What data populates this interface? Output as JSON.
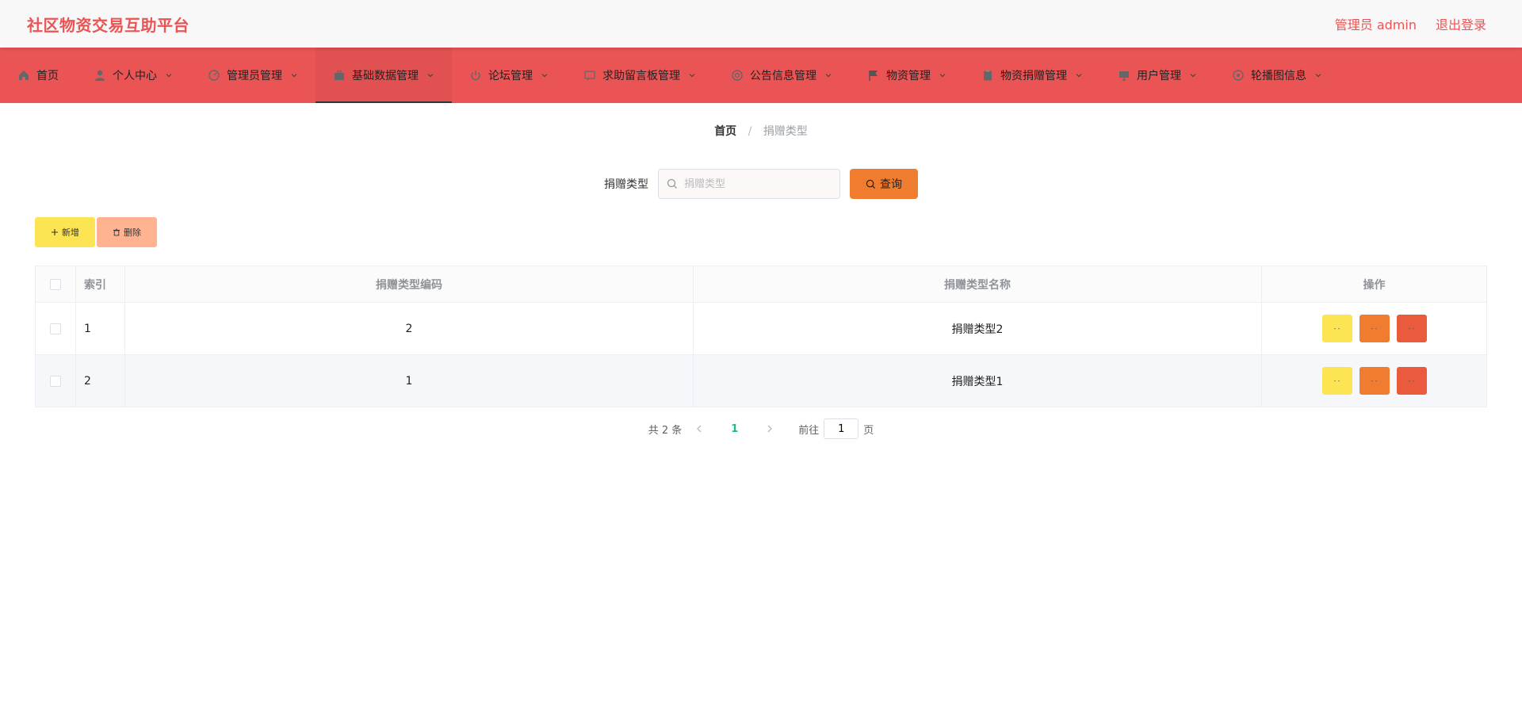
{
  "header": {
    "brand": "社区物资交易互助平台",
    "user_label": "管理员 admin",
    "logout_label": "退出登录"
  },
  "nav": {
    "items": [
      {
        "label": "首页",
        "icon": "home-icon",
        "has_menu": false
      },
      {
        "label": "个人中心",
        "icon": "user-icon",
        "has_menu": true
      },
      {
        "label": "管理员管理",
        "icon": "gauge-icon",
        "has_menu": true
      },
      {
        "label": "基础数据管理",
        "icon": "briefcase-icon",
        "has_menu": true,
        "active": true
      },
      {
        "label": "论坛管理",
        "icon": "power-icon",
        "has_menu": true
      },
      {
        "label": "求助留言板管理",
        "icon": "message-icon",
        "has_menu": true
      },
      {
        "label": "公告信息管理",
        "icon": "help-circle-icon",
        "has_menu": true
      },
      {
        "label": "物资管理",
        "icon": "flag-icon",
        "has_menu": true
      },
      {
        "label": "物资捐赠管理",
        "icon": "clipboard-icon",
        "has_menu": true
      },
      {
        "label": "用户管理",
        "icon": "monitor-icon",
        "has_menu": true
      },
      {
        "label": "轮播图信息",
        "icon": "settings-icon",
        "has_menu": true
      }
    ]
  },
  "breadcrumb": {
    "home": "首页",
    "separator": "/",
    "current": "捐赠类型"
  },
  "search": {
    "label": "捐赠类型",
    "placeholder": "捐赠类型",
    "button": "查询"
  },
  "actions": {
    "add": "新增",
    "delete": "删除"
  },
  "table": {
    "headers": {
      "index": "索引",
      "code": "捐赠类型编码",
      "name": "捐赠类型名称",
      "ops": "操作"
    },
    "rows": [
      {
        "index": "1",
        "code": "2",
        "name": "捐赠类型2"
      },
      {
        "index": "2",
        "code": "1",
        "name": "捐赠类型1"
      }
    ],
    "op_labels": {
      "view": "- -",
      "edit": "- -",
      "delete": "- -"
    }
  },
  "pager": {
    "total": "共 2 条",
    "current": "1",
    "goto_label": "前往",
    "goto_value": "1",
    "page_unit": "页"
  },
  "colors": {
    "brand": "#ea5455",
    "nav_bg": "#ea5455",
    "query": "#f07c2f",
    "add": "#fde452",
    "delete": "#ffb390",
    "active_page": "#1fb98a"
  }
}
